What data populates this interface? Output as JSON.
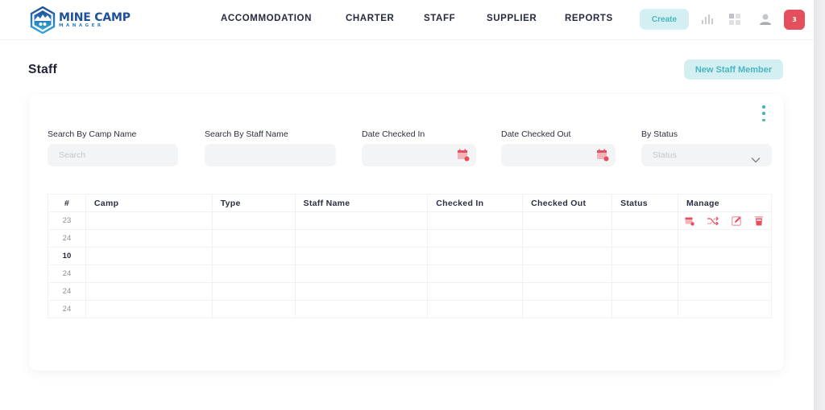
{
  "app": {
    "logo_title": "MINE CAMP",
    "logo_subtitle": "MANAGER"
  },
  "nav": {
    "items": [
      {
        "label": "ACCOMMODATION"
      },
      {
        "label": "CHARTER"
      },
      {
        "label": "STAFF"
      },
      {
        "label": "SUPPLIER"
      },
      {
        "label": "REPORTS"
      }
    ],
    "create_label": "Create",
    "icons": [
      "bar-chart-icon",
      "grid-icon",
      "user-icon"
    ],
    "notification_count": "3"
  },
  "page": {
    "title": "Staff",
    "new_button_label": "New Staff Member"
  },
  "filters": {
    "camp": {
      "label": "Search By Camp Name",
      "placeholder": "Search",
      "value": ""
    },
    "staff": {
      "label": "Search By Staff Name",
      "placeholder": "",
      "value": ""
    },
    "checked_in": {
      "label": "Date Checked In",
      "value": ""
    },
    "checked_out": {
      "label": "Date Checked Out",
      "value": ""
    },
    "status": {
      "label": "By Status",
      "selected": "Status"
    }
  },
  "table": {
    "columns": [
      "#",
      "Camp",
      "Type",
      "Staff Name",
      "Checked In",
      "Checked Out",
      "Status",
      "Manage"
    ],
    "rows": [
      {
        "num": "23",
        "camp": "",
        "type": "",
        "staff_name": "",
        "checked_in": "",
        "checked_out": "",
        "status": "",
        "bold": false,
        "actions": true
      },
      {
        "num": "24",
        "camp": "",
        "type": "",
        "staff_name": "",
        "checked_in": "",
        "checked_out": "",
        "status": "",
        "bold": false,
        "actions": false
      },
      {
        "num": "10",
        "camp": "",
        "type": "",
        "staff_name": "",
        "checked_in": "",
        "checked_out": "",
        "status": "",
        "bold": true,
        "actions": false
      },
      {
        "num": "24",
        "camp": "",
        "type": "",
        "staff_name": "",
        "checked_in": "",
        "checked_out": "",
        "status": "",
        "bold": false,
        "actions": false
      },
      {
        "num": "24",
        "camp": "",
        "type": "",
        "staff_name": "",
        "checked_in": "",
        "checked_out": "",
        "status": "",
        "bold": false,
        "actions": false
      },
      {
        "num": "24",
        "camp": "",
        "type": "",
        "staff_name": "",
        "checked_in": "",
        "checked_out": "",
        "status": "",
        "bold": false,
        "actions": false
      }
    ],
    "manage_actions": [
      "calendar-icon",
      "shuffle-icon",
      "edit-icon",
      "delete-icon"
    ]
  },
  "colors": {
    "accent": "#49b6bf",
    "accent_bg": "#d3eff2",
    "danger": "#e54f5d",
    "brand": "#1e4f9a"
  }
}
